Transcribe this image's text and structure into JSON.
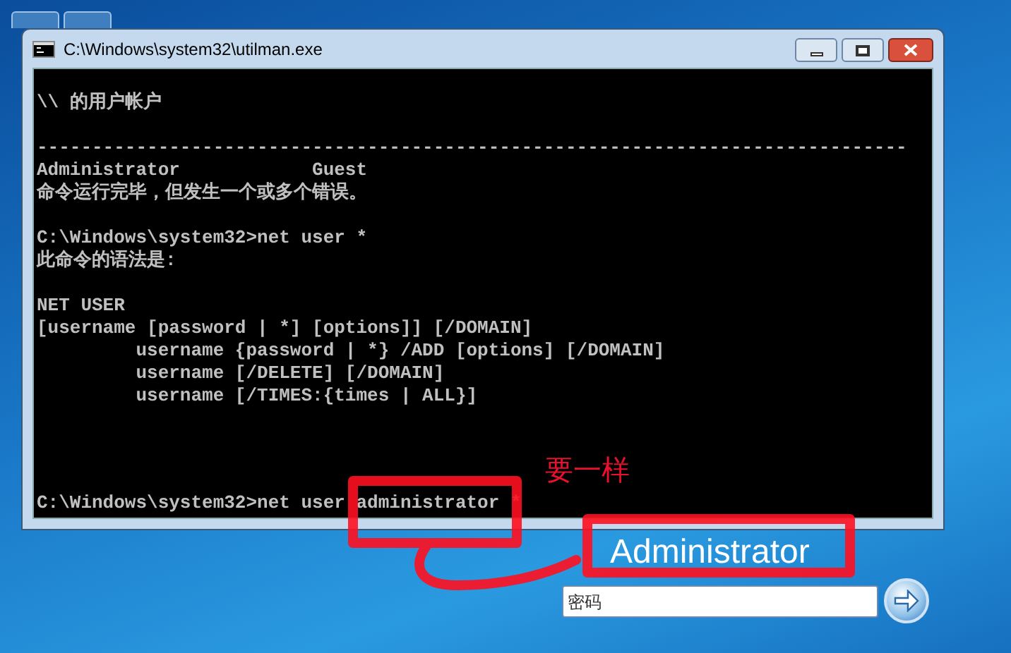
{
  "window": {
    "title": "C:\\Windows\\system32\\utilman.exe"
  },
  "console": {
    "blocks": [
      [
        "\\\\ 的用户帐户"
      ],
      [
        "-------------------------------------------------------------------------------",
        "Administrator            Guest",
        "命令运行完毕，但发生一个或多个错误。"
      ],
      [
        "C:\\Windows\\system32>net user *",
        "此命令的语法是:"
      ],
      [
        "NET USER",
        "[username [password | *] [options]] [/DOMAIN]",
        "         username {password | *} /ADD [options] [/DOMAIN]",
        "         username [/DELETE] [/DOMAIN]",
        "         username [/TIMES:{times | ALL}]"
      ],
      [
        "C:\\Windows\\system32>net user administrator *"
      ]
    ]
  },
  "annotation": {
    "text": "要一样"
  },
  "login": {
    "username": "Administrator",
    "password": {
      "placeholder": "密码"
    }
  }
}
